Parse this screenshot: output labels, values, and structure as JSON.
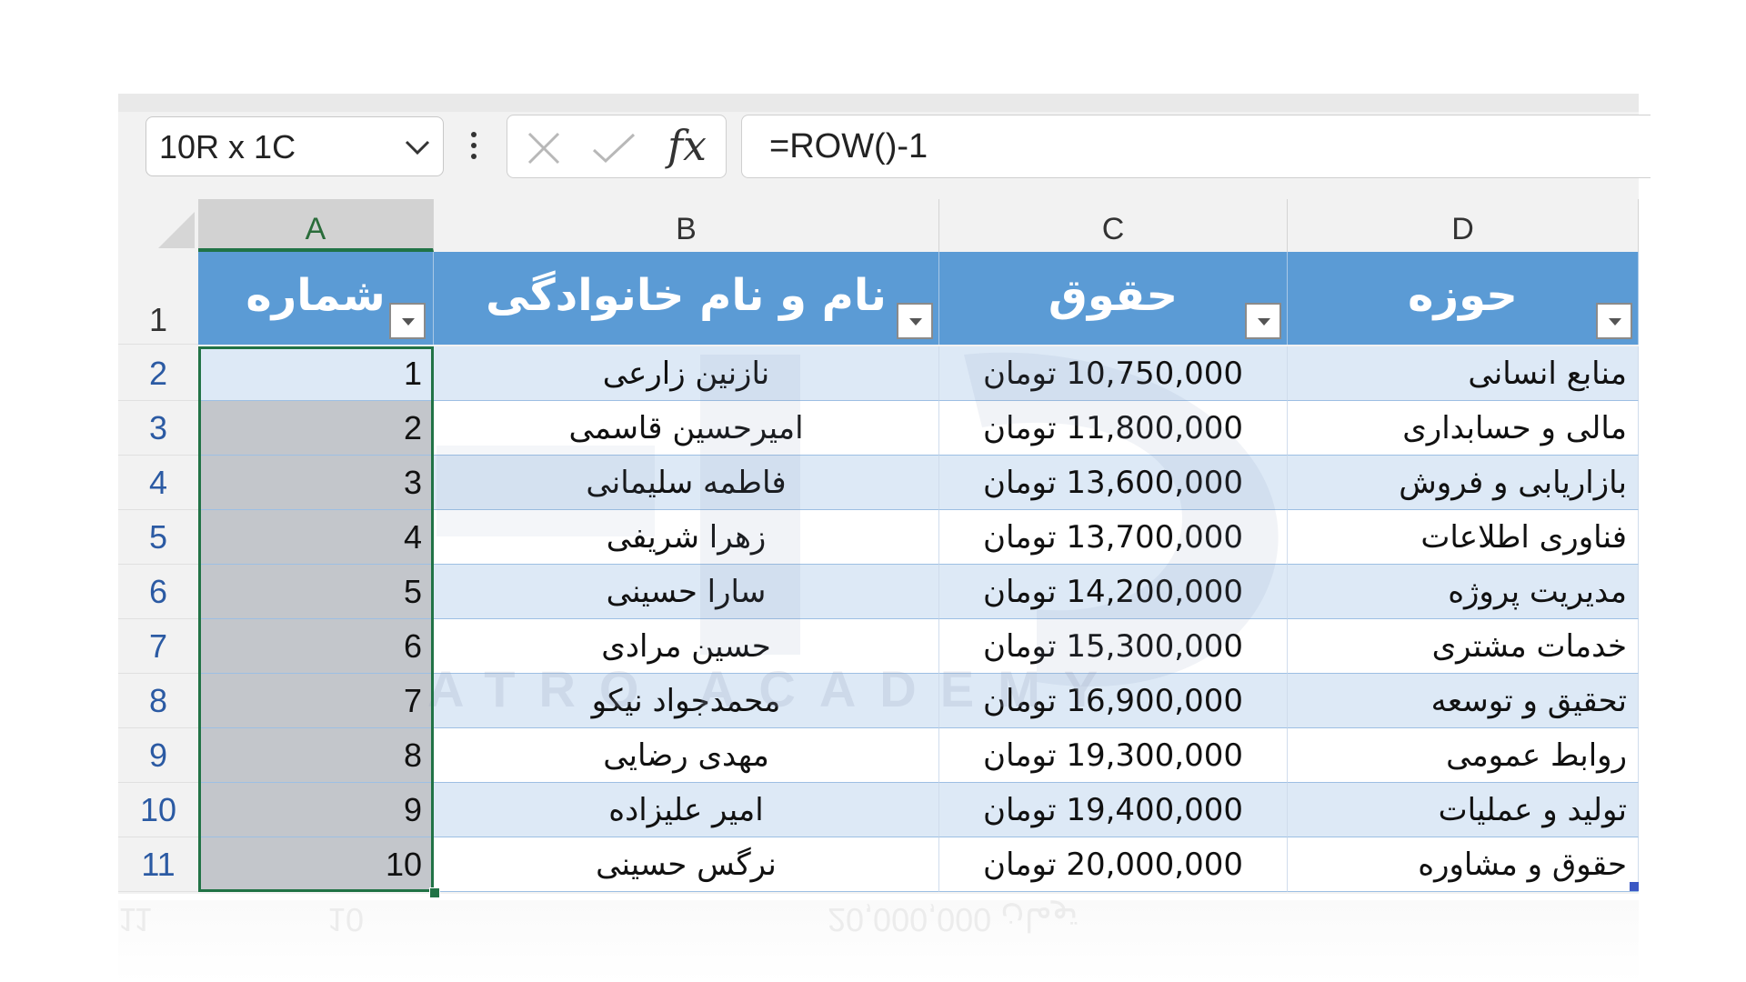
{
  "formula_bar": {
    "name_box": "10R x 1C",
    "fx_label": "fx",
    "formula": "=ROW()-1"
  },
  "columns": [
    "A",
    "B",
    "C",
    "D"
  ],
  "header_row_number": "1",
  "table_headers": {
    "a": "شماره",
    "b": "نام و نام خانوادگی",
    "c": "حقوق",
    "d": "حوزه"
  },
  "rows": [
    {
      "row": "2",
      "num": "1",
      "name": "نازنین زارعی",
      "salary": "10,750,000 تومان",
      "dept": "منابع انسانی"
    },
    {
      "row": "3",
      "num": "2",
      "name": "امیرحسین قاسمی",
      "salary": "11,800,000 تومان",
      "dept": "مالی و حسابداری"
    },
    {
      "row": "4",
      "num": "3",
      "name": "فاطمه سلیمانی",
      "salary": "13,600,000 تومان",
      "dept": "بازاریابی و فروش"
    },
    {
      "row": "5",
      "num": "4",
      "name": "زهرا شریفی",
      "salary": "13,700,000 تومان",
      "dept": "فناوری اطلاعات"
    },
    {
      "row": "6",
      "num": "5",
      "name": "سارا حسینی",
      "salary": "14,200,000 تومان",
      "dept": "مدیریت پروژه"
    },
    {
      "row": "7",
      "num": "6",
      "name": "حسین مرادی",
      "salary": "15,300,000 تومان",
      "dept": "خدمات مشتری"
    },
    {
      "row": "8",
      "num": "7",
      "name": "محمدجواد نیکو",
      "salary": "16,900,000 تومان",
      "dept": "تحقیق و توسعه"
    },
    {
      "row": "9",
      "num": "8",
      "name": "مهدی رضایی",
      "salary": "19,300,000 تومان",
      "dept": "روابط عمومی"
    },
    {
      "row": "10",
      "num": "9",
      "name": "امیر علیزاده",
      "salary": "19,400,000 تومان",
      "dept": "تولید و عملیات"
    },
    {
      "row": "11",
      "num": "10",
      "name": "نرگس حسینی",
      "salary": "20,000,000 تومان",
      "dept": "حقوق و مشاوره"
    }
  ],
  "watermark": "ATRO ACADEMY",
  "colors": {
    "header_blue": "#5b9bd5",
    "band_blue": "#dde9f6",
    "selection_green": "#217346",
    "selected_fill": "#c3c6cb"
  }
}
